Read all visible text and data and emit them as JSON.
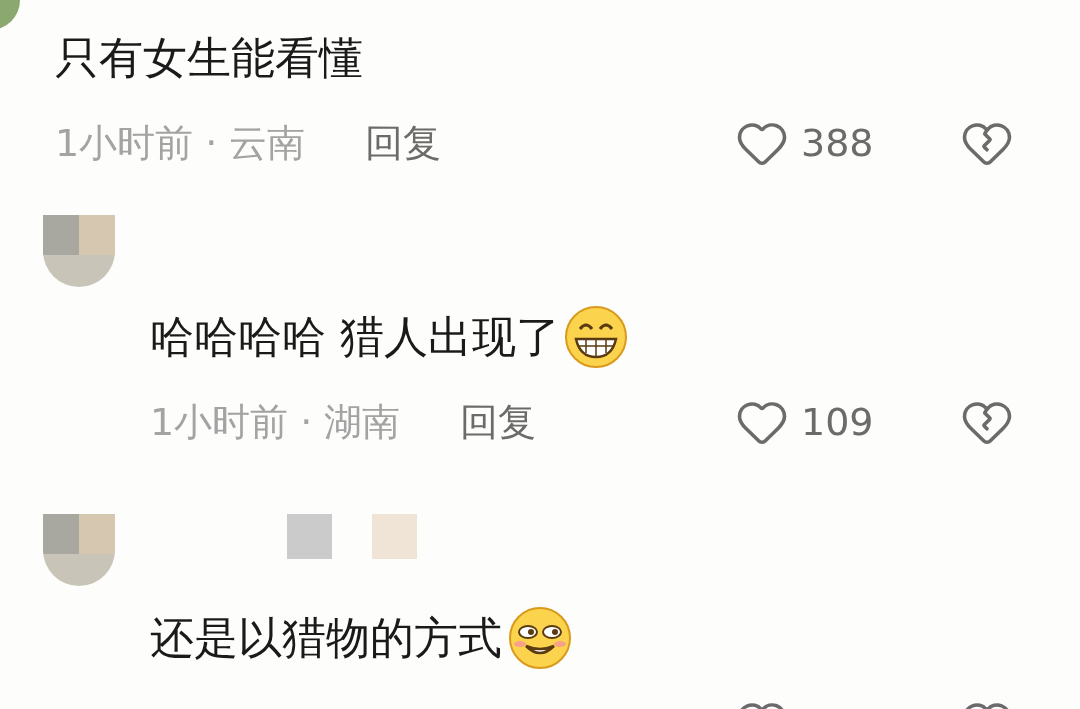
{
  "comments": [
    {
      "avatar": {
        "kind": "cut"
      },
      "indent": false,
      "text": "只有女生能看懂",
      "time_location": "1小时前 · 云南",
      "reply": "回复",
      "likes": "388"
    },
    {
      "avatar": {
        "kind": "mosaic"
      },
      "indent": true,
      "text": "哈哈哈哈 猎人出现了",
      "emoji": {
        "kind": "grin"
      },
      "time_location": "1小时前 · 湖南",
      "reply": "回复",
      "likes": "109"
    },
    {
      "avatar": {
        "kind": "mosaic"
      },
      "indent": true,
      "text": "还是以猎物的方式",
      "emoji": {
        "kind": "smirk"
      }
    }
  ]
}
